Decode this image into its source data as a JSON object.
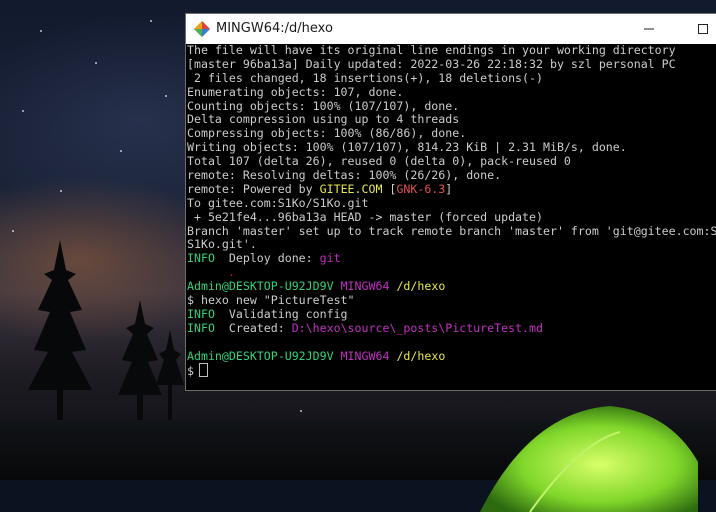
{
  "window": {
    "title": "MINGW64:/d/hexo"
  },
  "terminal": {
    "lines": [
      "The file will have its original line endings in your working directory",
      "[master 96ba13a] Daily updated: 2022-03-26 22:18:32 by szl personal PC",
      " 2 files changed, 18 insertions(+), 18 deletions(-)",
      "Enumerating objects: 107, done.",
      "Counting objects: 100% (107/107), done.",
      "Delta compression using up to 4 threads",
      "Compressing objects: 100% (86/86), done.",
      "Writing objects: 100% (107/107), 814.23 KiB | 2.31 MiB/s, done.",
      "Total 107 (delta 26), reused 0 (delta 0), pack-reused 0",
      "remote: Resolving deltas: 100% (26/26), done."
    ],
    "powered": {
      "prefix": "remote: Powered by ",
      "brand": "GITEE.COM",
      "open": " [",
      "gnk": "GNK-6.3",
      "close": "]"
    },
    "lines2": [
      "To gitee.com:S1Ko/S1Ko.git",
      " + 5e21fe4...96ba13a HEAD -> master (forced update)",
      "Branch 'master' set up to track remote branch 'master' from 'git@gitee.com:S",
      "S1Ko.git'."
    ],
    "deploy": {
      "tag": "INFO",
      "text": "  Deploy done: ",
      "target": "git"
    },
    "stray_dot": ".",
    "prompt1": {
      "user_host": "Admin@DESKTOP-U92JD9V",
      "env": "MINGW64",
      "path": "/d/hexo"
    },
    "command": "$ hexo new \"PictureTest\"",
    "validating": {
      "tag": "INFO",
      "text": "  Validating config"
    },
    "created": {
      "tag": "INFO",
      "text": "  Created: ",
      "path": "D:\\hexo\\source\\_posts\\PictureTest.md"
    },
    "prompt2": {
      "user_host": "Admin@DESKTOP-U92JD9V",
      "env": "MINGW64",
      "path": "/d/hexo"
    },
    "input_prompt": "$"
  },
  "colors": {
    "info_green": "#33d17a",
    "path_yellow": "#e8e84a",
    "env_magenta": "#c030c0"
  }
}
